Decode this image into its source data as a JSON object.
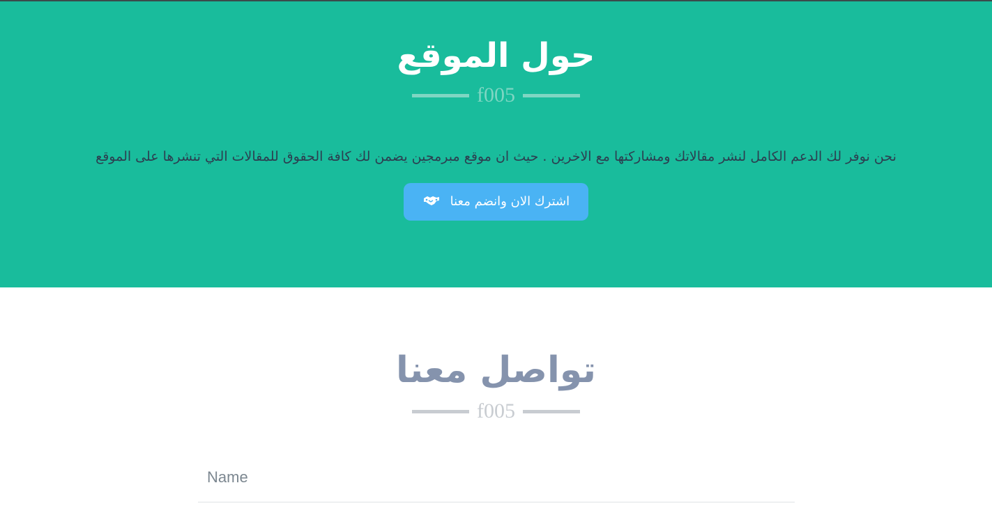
{
  "about": {
    "title": "حول الموقع",
    "divider_glyph": "f005",
    "description": "نحن نوفر لك الدعم الكامل لنشر مقالاتك ومشاركتها مع الاخرين . حيث ان موقع مبرمجين يضمن لك كافة الحقوق للمقالات التي تنشرها  على الموقع",
    "button_label": "اشترك الان وانضم معنا",
    "button_icon": "handshake-icon"
  },
  "contact": {
    "title": "تواصل معنا",
    "divider_glyph": "f005",
    "name_placeholder": "Name"
  },
  "colors": {
    "about_background": "#19bc9c",
    "button_background": "#4ab3f4",
    "contact_title": "#8593ad"
  }
}
